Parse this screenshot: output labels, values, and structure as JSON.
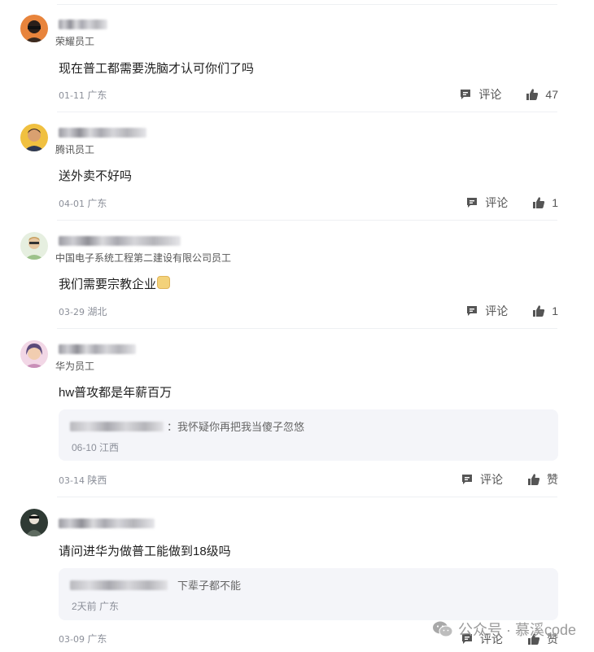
{
  "comments": [
    {
      "badge": "荣耀员工",
      "text": "现在普工都需要洗脑才认可你们了吗",
      "date": "01-11",
      "location": "广东",
      "reply_label": "评论",
      "like_count": "47"
    },
    {
      "badge": "腾讯员工",
      "text": "送外卖不好吗",
      "date": "04-01",
      "location": "广东",
      "reply_label": "评论",
      "like_count": "1"
    },
    {
      "badge": "中国电子系统工程第二建设有限公司员工",
      "text": "我们需要宗教企业",
      "date": "03-29",
      "location": "湖北",
      "reply_label": "评论",
      "like_count": "1"
    },
    {
      "badge": "华为员工",
      "text": "hw普攻都是年薪百万",
      "date": "03-14",
      "location": "陕西",
      "reply_label": "评论",
      "like_count": "赞",
      "reply": {
        "text": "我怀疑你再把我当傻子忽悠",
        "separator": "：",
        "date": "06-10",
        "location": "江西"
      }
    },
    {
      "badge": "",
      "text": "请问进华为做普工能做到18级吗",
      "date": "03-09",
      "location": "广东",
      "reply_label": "评论",
      "like_count": "赞",
      "reply": {
        "text": "下辈子都不能",
        "separator": "",
        "date": "2天前",
        "location": "广东"
      }
    }
  ],
  "watermark": {
    "text": "公众号 · 慕溪code"
  },
  "colors": {
    "divider": "#eef0f3",
    "reply_bg": "#f4f5f9",
    "meta": "#8b8f99",
    "icon": "#555555"
  },
  "icons": [
    "comment-icon",
    "thumbs-up-icon",
    "wechat-icon",
    "emoji-icon"
  ]
}
